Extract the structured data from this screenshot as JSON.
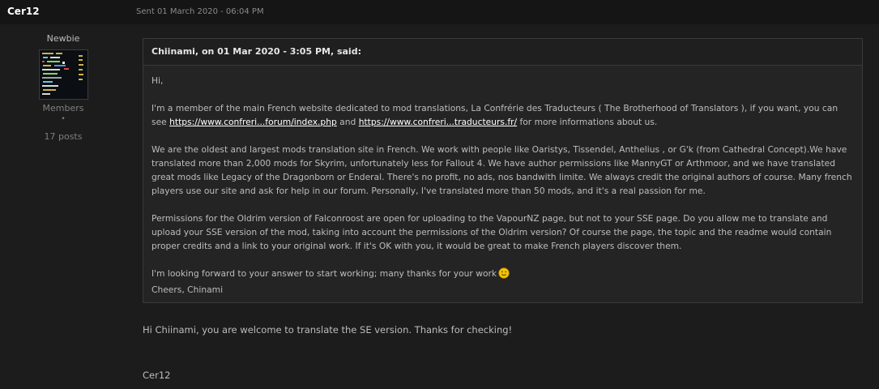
{
  "post": {
    "author": "Cer12",
    "date": "Sent 01 March 2020 - 06:04 PM"
  },
  "author_info": {
    "rank": "Newbie",
    "group": "Members",
    "separator": "•",
    "post_count": "17 posts"
  },
  "quote": {
    "header": "Chiinami, on 01 Mar 2020 - 3:05 PM, said:",
    "greeting": "Hi,",
    "p1_text": "I'm a member of the main French website dedicated to mod translations, La Confrérie des Traducteurs ( The Brotherhood of Translators ), if you want, you can see ",
    "link1": "https://www.confreri...forum/index.php",
    "p1_and": " and ",
    "link2": "https://www.confreri...traducteurs.fr/",
    "p1_end": " for more informations about us.",
    "p2": "We are the oldest and largest mods translation site in French. We work with people like Oaristys, Tissendel, Anthelius , or G'k (from Cathedral Concept).We have translated more than 2,000 mods for Skyrim, unfortunately less for Fallout 4. We have author permissions like MannyGT or Arthmoor, and we have translated great mods like Legacy of the Dragonborn or Enderal. There's no profit, no ads, nos bandwith limite. We always credit the original authors of course. Many french players use our site and ask for help in our forum. Personally, I've translated more than 50 mods, and it's a real passion for me.",
    "p3": "Permissions for the Oldrim version of Falconroost are open for uploading to the VapourNZ page, but not to your SSE page. Do you allow me to translate and upload your SSE version of the mod, taking into account the permissions of the Oldrim version? Of course the page, the topic and the readme would contain proper credits and a link to your original work. If it's OK with you, it would be great to make French players discover them.",
    "p4_line1": "I'm looking forward to your answer to start working; many thanks for your work",
    "p4_line2": "Cheers, Chinami"
  },
  "reply": "Hi Chiinami, you are welcome to translate the SE version. Thanks for checking!",
  "signature": "Cer12",
  "colors": {
    "link": "#ffffff",
    "text": "#bdbdbd",
    "muted": "#7f7f7f",
    "smiley": "#f5c400"
  }
}
